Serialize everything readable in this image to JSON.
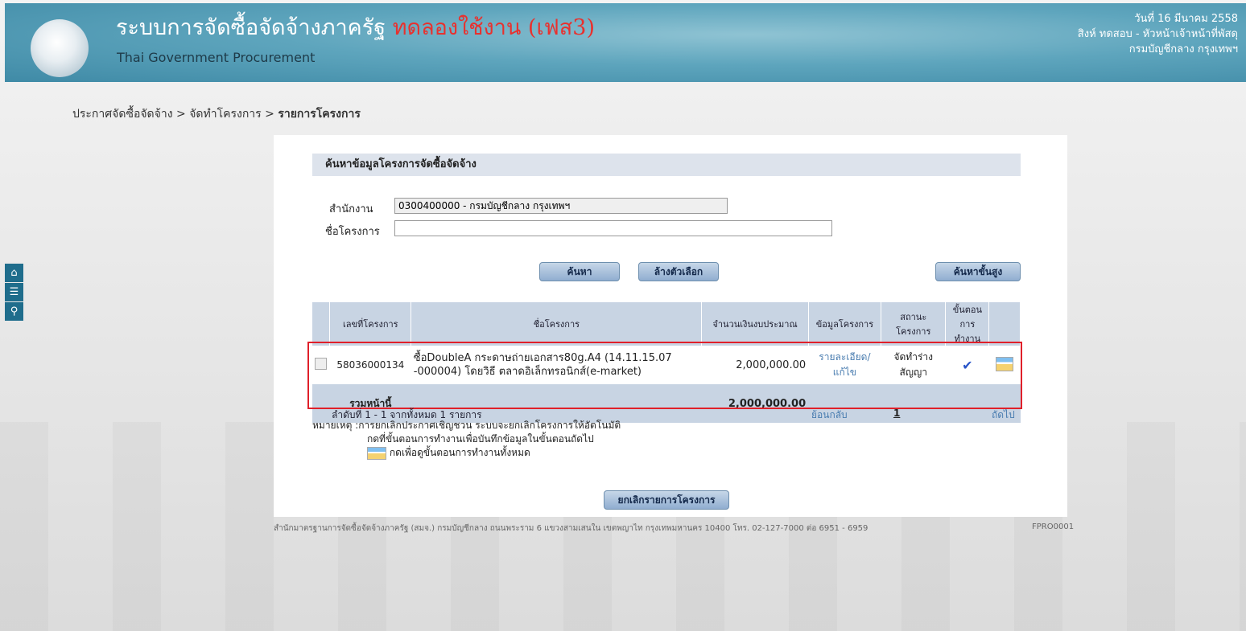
{
  "header": {
    "title_main": "ระบบการจัดซื้อจัดจ้างภาครัฐ",
    "title_highlight": "ทดลองใช้งาน (เฟส3)",
    "subtitle": "Thai Government Procurement",
    "date": "วันที่ 16 มีนาคม 2558",
    "user": "สิงห์ ทดสอบ - หัวหน้าเจ้าหน้าที่พัสดุ",
    "department": "กรมบัญชีกลาง กรุงเทพฯ"
  },
  "breadcrumb": {
    "item1": "ประกาศจัดซื้อจัดจ้าง",
    "sep": ">",
    "item2": "จัดทำโครงการ",
    "item3": "รายการโครงการ"
  },
  "sidenav": {
    "icons": [
      "home-icon",
      "menu-icon",
      "search-icon"
    ]
  },
  "search": {
    "section_title": "ค้นหาข้อมูลโครงการจัดซื้อจัดจ้าง",
    "office_label": "สำนักงาน",
    "office_value": "0300400000 - กรมบัญชีกลาง กรุงเทพฯ",
    "project_label": "ชื่อโครงการ",
    "project_value": "",
    "search_btn": "ค้นหา",
    "clear_btn": "ล้างตัวเลือก",
    "advanced_btn": "ค้นหาขั้นสูง"
  },
  "table": {
    "headers": {
      "id": "เลขที่โครงการ",
      "name": "ชื่อโครงการ",
      "budget": "จำนวนเงินงบประมาณ",
      "info": "ข้อมูลโครงการ",
      "status": "สถานะโครงการ",
      "step": "ขั้นตอนการทำงาน"
    },
    "row": {
      "id": "58036000134",
      "name": "ซื้อDoubleA กระดาษถ่ายเอกสาร80g.A4 (14.11.15.07 -000004) โดยวิธี ตลาดอิเล็กทรอนิกส์(e-market)",
      "budget": "2,000,000.00",
      "info_link": "รายละเอียด/แก้ไข",
      "status": "จัดทำร่างสัญญา",
      "step_icon": "checkmark-icon",
      "steps_icon": "steps-icon"
    },
    "summary": {
      "label": "รวมหน้านี้",
      "total": "2,000,000.00"
    }
  },
  "pager": {
    "info": "ลำดับที่ 1 - 1 จากทั้งหมด 1 รายการ",
    "prev": "ย้อนกลับ",
    "page": "1",
    "next": "ถัดไป"
  },
  "notes": {
    "line1": "หมายเหตุ :การยกเลิกประกาศเชิญชวน ระบบจะยกเลิกโครงการให้อัตโนมัติ",
    "line2": "กดที่ขั้นตอนการทำงานเพื่อบันทึกข้อมูลในขั้นตอนถัดไป",
    "line3": "กดเพื่อดูขั้นตอนการทำงานทั้งหมด"
  },
  "cancel_btn": "ยกเลิกรายการโครงการ",
  "footer": {
    "text": "สำนักมาตรฐานการจัดซื้อจัดจ้างภาครัฐ (สมจ.) กรมบัญชีกลาง ถนนพระราม 6 แขวงสามเสนใน เขตพญาไท กรุงเทพมหานคร 10400 โทร. 02-127-7000 ต่อ 6951 - 6959",
    "code": "FPRO0001"
  }
}
